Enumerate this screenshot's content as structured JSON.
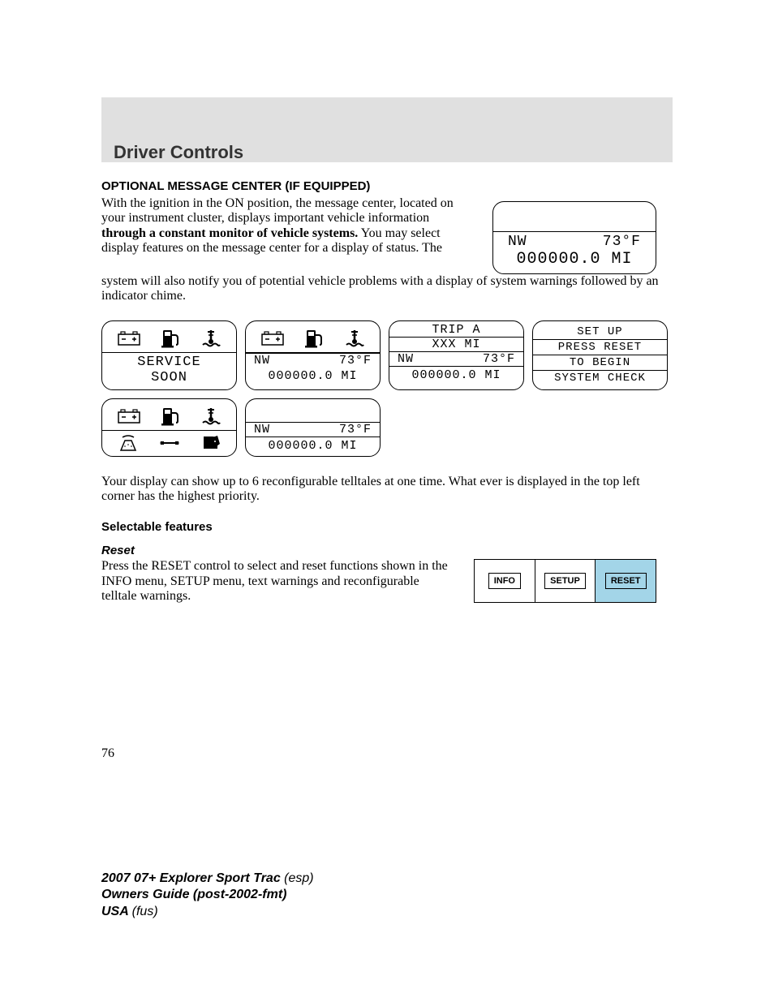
{
  "header": {
    "title": "Driver Controls"
  },
  "section": {
    "heading": "OPTIONAL MESSAGE CENTER (IF EQUIPPED)"
  },
  "intro": {
    "p1a": "With the ignition in the ON position, the message center, located on your instrument cluster, displays important vehicle information ",
    "p1b": "through a constant monitor of vehicle systems.",
    "p1c": " You may select display features on the message center for a display of status. The",
    "p2": "system will also notify you of potential vehicle problems with a display of system warnings followed by an indicator chime."
  },
  "main_display": {
    "compass": "NW",
    "temp": "73°F",
    "odo": "000000.0 MI"
  },
  "panels": {
    "p1": {
      "line1": "SERVICE",
      "line2": "SOON"
    },
    "p2": {
      "compass": "NW",
      "temp": "73°F",
      "odo": "000000.0 MI"
    },
    "p3": {
      "title1": "TRIP A",
      "title2": "XXX MI",
      "compass": "NW",
      "temp": "73°F",
      "odo": "000000.0 MI"
    },
    "p4": {
      "r1": "SET UP",
      "r2": "PRESS RESET",
      "r3": "TO BEGIN",
      "r4": "SYSTEM CHECK"
    },
    "p6": {
      "compass": "NW",
      "temp": "73°F",
      "odo": "000000.0 MI"
    }
  },
  "post_grid": "Your display can show up to 6 reconfigurable telltales at one time. What ever is displayed in the top left corner has the highest priority.",
  "selectable": {
    "heading": "Selectable features"
  },
  "reset": {
    "heading": "Reset",
    "body": "Press the RESET control to select and reset functions shown in the INFO menu, SETUP menu, text warnings and reconfigurable telltale warnings."
  },
  "buttons": {
    "info": "INFO",
    "setup": "SETUP",
    "reset": "RESET"
  },
  "page_number": "76",
  "footer": {
    "l1a": "2007 07+ Explorer Sport Trac ",
    "l1b": "(esp)",
    "l2a": "Owners Guide (post-2002-fmt)",
    "l3a": "USA ",
    "l3b": "(fus)"
  }
}
